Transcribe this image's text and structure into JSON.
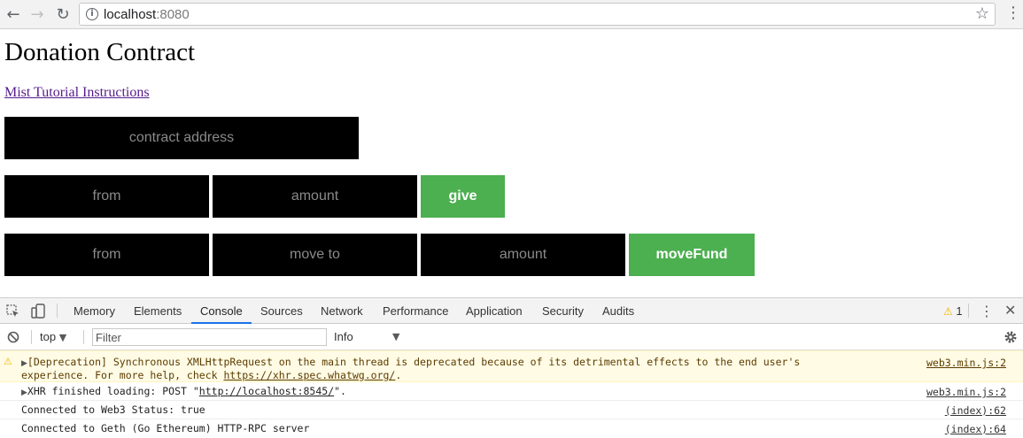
{
  "browser": {
    "back_icon": "back-arrow-icon",
    "forward_icon": "forward-arrow-icon",
    "reload_icon": "reload-icon",
    "url_host": "localhost",
    "url_port": ":8080",
    "star_icon": "bookmark-star-icon",
    "menu_icon": "kebab-menu-icon"
  },
  "page": {
    "title": "Donation Contract",
    "link": "Mist Tutorial Instructions",
    "contract_address_placeholder": "contract address",
    "give": {
      "from_placeholder": "from",
      "amount_placeholder": "amount",
      "button_label": "give"
    },
    "move": {
      "from_placeholder": "from",
      "move_to_placeholder": "move to",
      "amount_placeholder": "amount",
      "button_label": "moveFund"
    },
    "colors": {
      "field_bg": "#000000",
      "button_bg": "#4caf50"
    }
  },
  "devtools": {
    "tabs": [
      "Memory",
      "Elements",
      "Console",
      "Sources",
      "Network",
      "Performance",
      "Application",
      "Security",
      "Audits"
    ],
    "active_tab": "Console",
    "warning_count": "1",
    "context": "top",
    "filter_placeholder": "Filter",
    "level": "Info",
    "logs": [
      {
        "type": "warning",
        "line1": "[Deprecation] Synchronous XMLHttpRequest on the main thread is deprecated because of its detrimental effects to the end user's",
        "line2_prefix": "experience. For more help, check ",
        "line2_link": "https://xhr.spec.whatwg.org/",
        "line2_suffix": ".",
        "source": "web3.min.js:2"
      },
      {
        "type": "info",
        "prefix": "XHR finished loading: POST \"",
        "link": "http://localhost:8545/",
        "suffix": "\".",
        "source": "web3.min.js:2"
      },
      {
        "type": "log",
        "text": "Connected to Web3 Status: true",
        "source": "(index):62"
      },
      {
        "type": "log",
        "text": "Connected to Geth (Go Ethereum) HTTP-RPC server",
        "source": "(index):64"
      }
    ]
  }
}
